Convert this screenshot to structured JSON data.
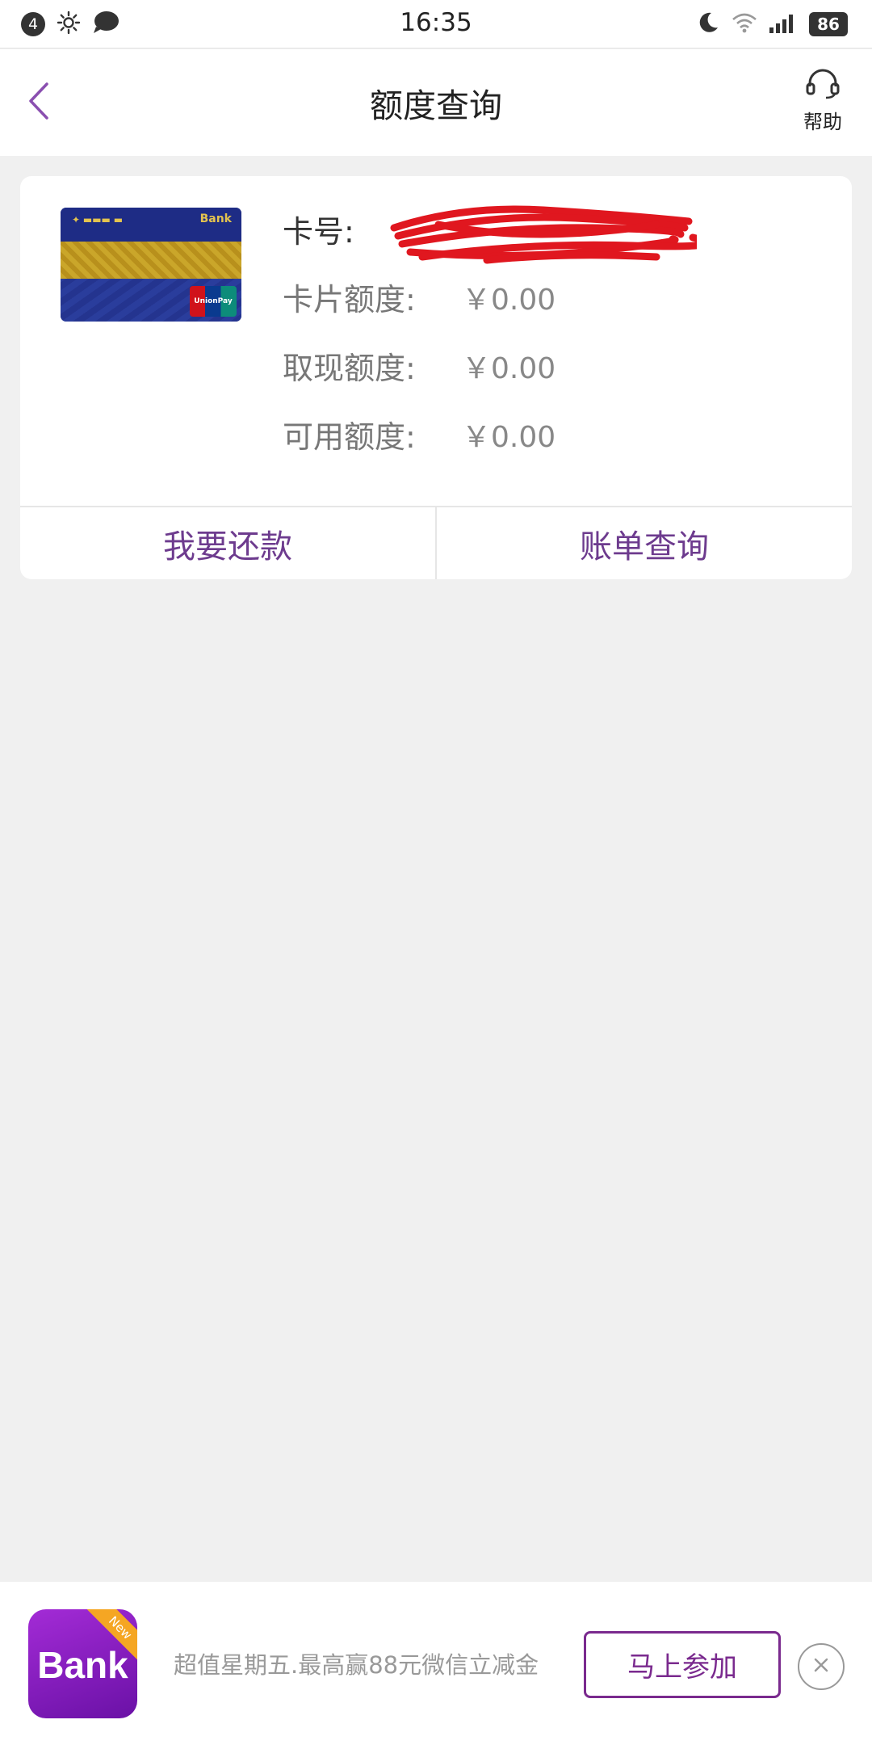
{
  "status_bar": {
    "notification_count": "4",
    "time": "16:35",
    "battery": "86",
    "icons_left": [
      "brightness-icon",
      "message-icon"
    ],
    "icons_right": [
      "moon-icon",
      "wifi-icon",
      "signal-icon"
    ]
  },
  "nav": {
    "title": "额度查询",
    "help_label": "帮助",
    "back_icon": "chevron-left-icon",
    "help_icon": "headset-icon"
  },
  "card": {
    "card_no_label": "卡号:",
    "rows": [
      {
        "label": "卡片额度:",
        "value": "￥0.00"
      },
      {
        "label": "取现额度:",
        "value": "￥0.00"
      },
      {
        "label": "可用额度:",
        "value": "￥0.00"
      }
    ],
    "actions": {
      "repay": "我要还款",
      "bill": "账单查询"
    }
  },
  "promo": {
    "logo_text": "Bank",
    "logo_badge": "New",
    "text": "超值星期五.最高赢88元微信立减金",
    "join_label": "马上参加"
  },
  "colors": {
    "accent": "#6d3b8e",
    "background": "#f0f0f0",
    "redaction": "#e0171f"
  }
}
